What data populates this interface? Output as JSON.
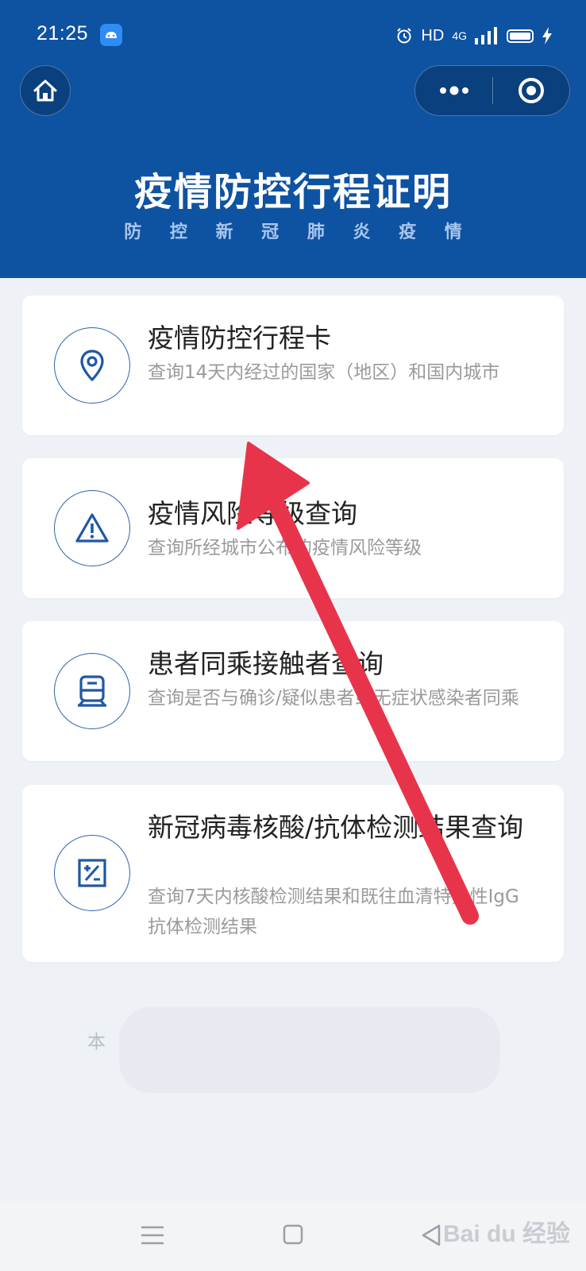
{
  "status_bar": {
    "time": "21:25",
    "network": "HD",
    "signal": "4G",
    "icons": [
      "android-app-icon",
      "alarm-icon",
      "signal-icon",
      "battery-icon",
      "charging-icon"
    ]
  },
  "nav": {
    "home_icon": "home-icon",
    "more_icon": "more-dots-icon",
    "close_icon": "target-close-icon"
  },
  "banner": {
    "title": "疫情防控行程证明",
    "subtitle": "防 控 新 冠 肺 炎 疫 情"
  },
  "cards": [
    {
      "title": "疫情防控行程卡",
      "desc": "查询14天内经过的国家（地区）和国内城市",
      "icon": "location-pin-icon"
    },
    {
      "title": "疫情风险等级查询",
      "desc": "查询所经城市公布的疫情风险等级",
      "icon": "warning-icon"
    },
    {
      "title": "患者同乘接触者查询",
      "desc": "查询是否与确诊/疑似患者或无症状感染者同乘",
      "icon": "train-icon"
    },
    {
      "title": "新冠病毒核酸/抗体检测结果查询",
      "desc": "查询7天内核酸检测结果和既往血清特异性IgG抗体检测结果",
      "icon": "test-report-icon"
    }
  ],
  "footer": {
    "note_prefix": "本"
  },
  "android_nav": {
    "icons": [
      "menu-icon",
      "square-home-icon",
      "back-triangle-icon"
    ]
  },
  "watermark": {
    "text": "Bai du 经验"
  },
  "colors": {
    "header_blue": "#0e52a2",
    "icon_blue": "#2b64ad",
    "arrow_red": "#e8344a"
  }
}
